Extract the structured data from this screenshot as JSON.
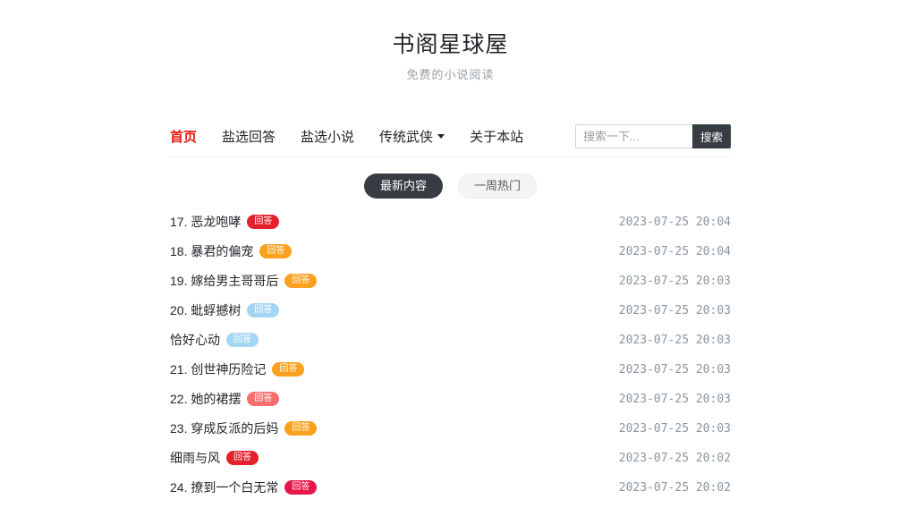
{
  "header": {
    "title": "书阁星球屋",
    "subtitle": "免费的小说阅读"
  },
  "nav": {
    "items": [
      {
        "label": "首页",
        "active": true,
        "dropdown": false
      },
      {
        "label": "盐选回答",
        "active": false,
        "dropdown": false
      },
      {
        "label": "盐选小说",
        "active": false,
        "dropdown": false
      },
      {
        "label": "传统武侠",
        "active": false,
        "dropdown": true
      },
      {
        "label": "关于本站",
        "active": false,
        "dropdown": false
      }
    ]
  },
  "search": {
    "placeholder": "搜索一下...",
    "button_label": "搜索"
  },
  "tabs": [
    {
      "label": "最新内容",
      "active": true
    },
    {
      "label": "一周热门",
      "active": false
    }
  ],
  "colors": {
    "accent_red": "#e8160c",
    "dark_button": "#383d43",
    "badge_red": "#e4202c",
    "badge_orange": "#fca01f",
    "badge_blue": "#a4d6f4",
    "badge_salmon": "#f56f6f",
    "badge_rose": "#e8174b"
  },
  "list": {
    "badge_label": "回答",
    "items": [
      {
        "title": "17. 恶龙咆哮",
        "badge_color": "#e4202c",
        "time": "2023-07-25 20:04"
      },
      {
        "title": "18. 暴君的偏宠",
        "badge_color": "#fca01f",
        "time": "2023-07-25 20:04"
      },
      {
        "title": "19. 嫁给男主哥哥后",
        "badge_color": "#fca01f",
        "time": "2023-07-25 20:03"
      },
      {
        "title": "20. 蚍蜉撼树",
        "badge_color": "#a4d6f4",
        "time": "2023-07-25 20:03"
      },
      {
        "title": "恰好心动",
        "badge_color": "#a4d6f4",
        "time": "2023-07-25 20:03"
      },
      {
        "title": "21. 创世神历险记",
        "badge_color": "#fca01f",
        "time": "2023-07-25 20:03"
      },
      {
        "title": "22. 她的裙摆",
        "badge_color": "#f56f6f",
        "time": "2023-07-25 20:03"
      },
      {
        "title": "23. 穿成反派的后妈",
        "badge_color": "#fca01f",
        "time": "2023-07-25 20:03"
      },
      {
        "title": "细雨与风",
        "badge_color": "#e4202c",
        "time": "2023-07-25 20:02"
      },
      {
        "title": "24. 撩到一个白无常",
        "badge_color": "#e8174b",
        "time": "2023-07-25 20:02"
      }
    ]
  }
}
